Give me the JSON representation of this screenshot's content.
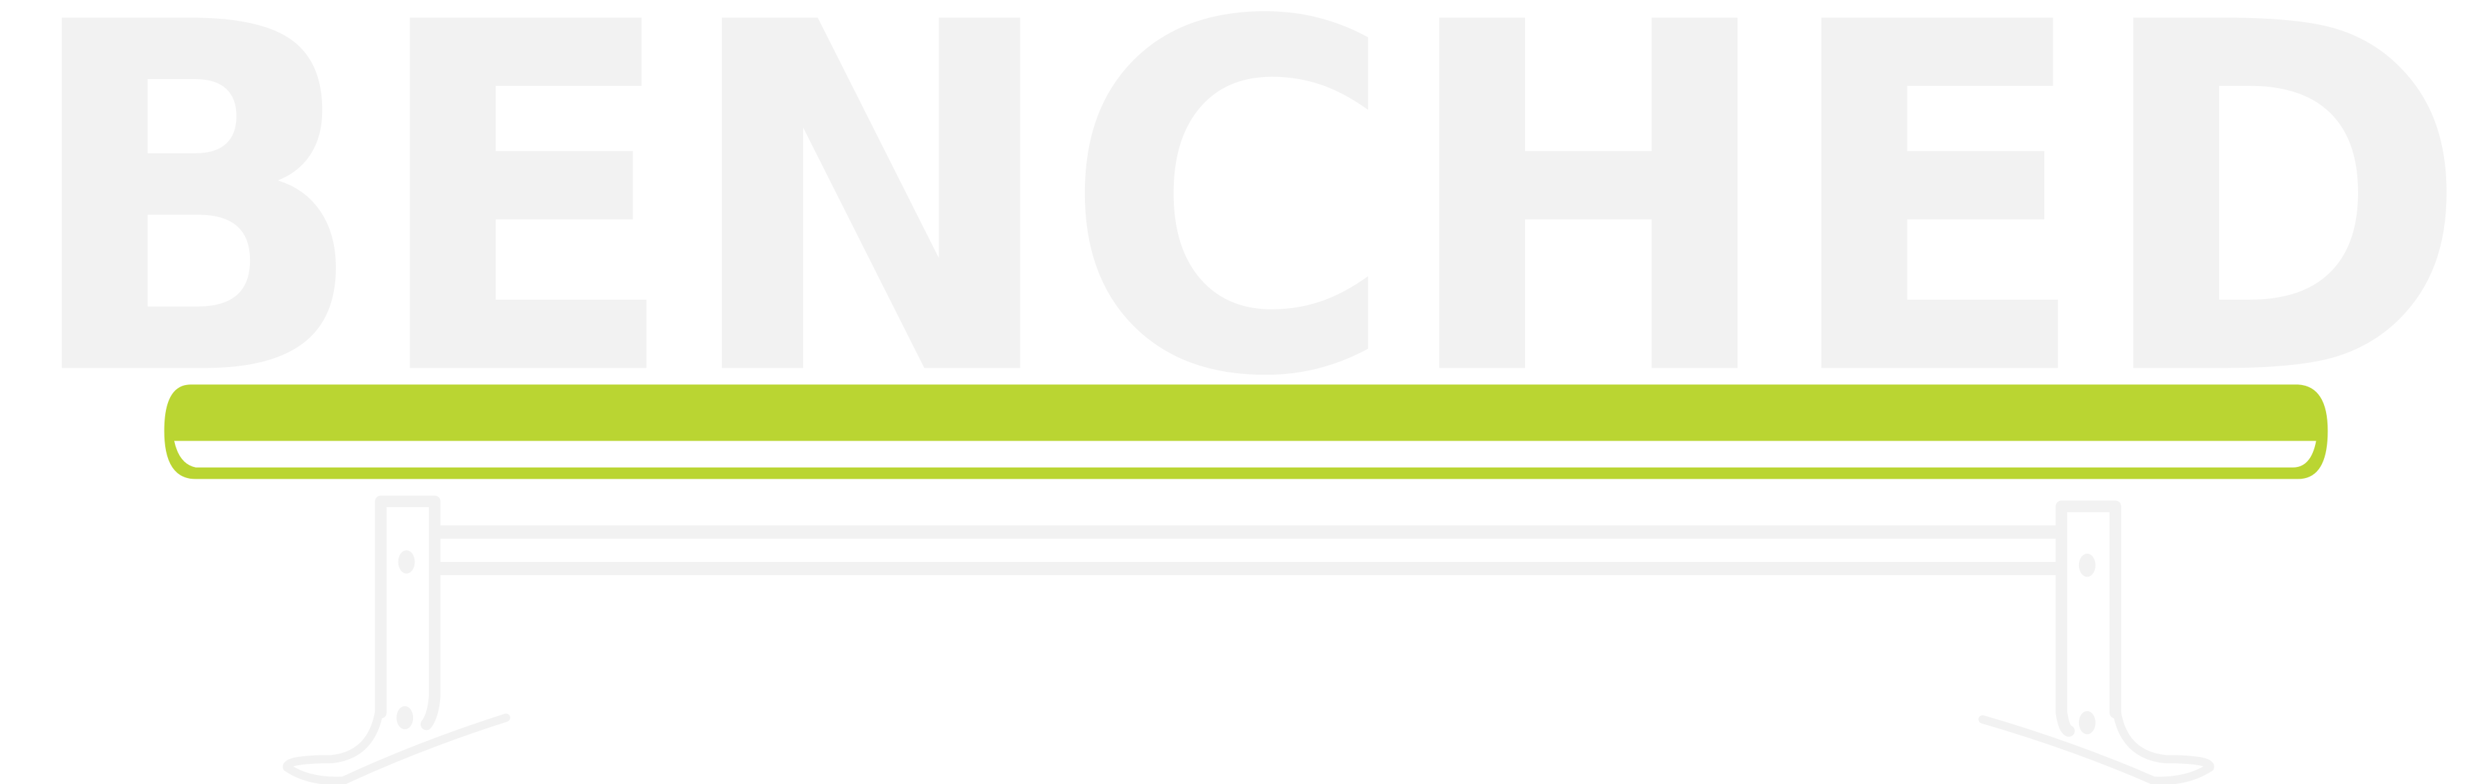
{
  "brand": {
    "name": "BENCHED",
    "logo_icon": "bench-icon"
  },
  "colors": {
    "background": "#ffffff",
    "lettering": "#f2f2f2",
    "bench_seat": "#bad532",
    "bench_frame": "#f2f2f2"
  }
}
